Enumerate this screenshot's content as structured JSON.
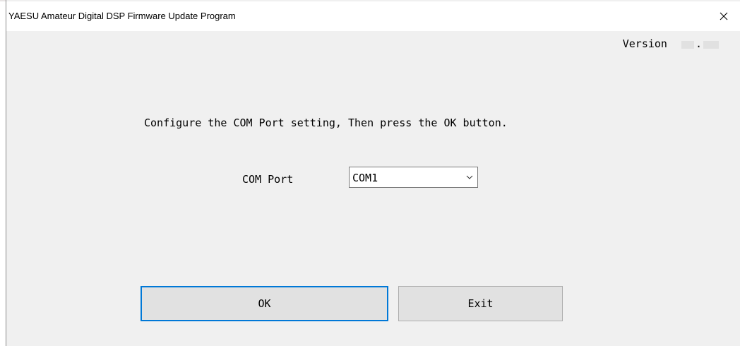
{
  "window": {
    "title": "YAESU Amateur Digital DSP Firmware Update Program",
    "close_symbol": "×"
  },
  "version": {
    "label": "Version",
    "separator": "."
  },
  "main": {
    "instruction": "Configure the COM Port setting, Then press the OK button.",
    "com_port_label": "COM Port",
    "com_port_value": "COM1"
  },
  "buttons": {
    "ok_label": "OK",
    "exit_label": "Exit"
  },
  "icons": {
    "close": "close-icon",
    "dropdown": "chevron-down-icon"
  },
  "colors": {
    "focus_border": "#0078d7",
    "window_bg": "#f0f0f0",
    "button_bg": "#e1e1e1"
  }
}
